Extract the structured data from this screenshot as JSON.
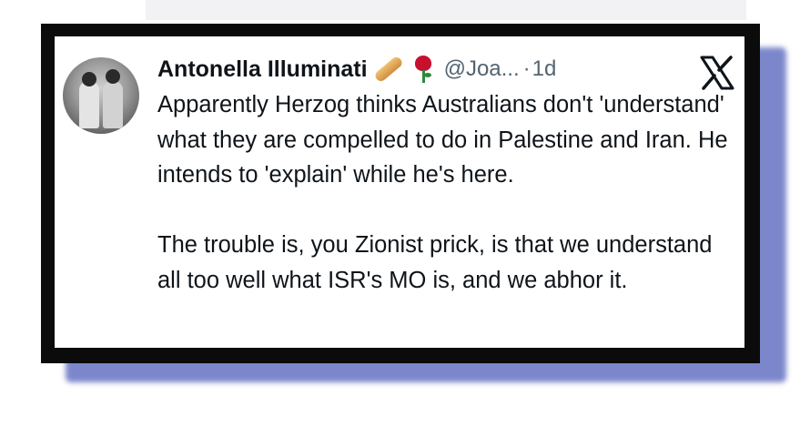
{
  "post": {
    "author_name": "Antonella Illuminati",
    "author_emojis": [
      "baguette-emoji",
      "rose-emoji"
    ],
    "handle": "@Joa...",
    "separator": "·",
    "time_ago": "1d",
    "platform_logo": "x-logo-icon",
    "paragraphs": [
      "Apparently Herzog thinks Australians don't 'understand' what they are compelled to do in Palestine and Iran. He intends to 'explain' while he's here.",
      "The trouble is, you Zionist prick, is that we understand all too well what ISR's MO is, and we abhor it."
    ]
  },
  "colors": {
    "frame": "#0b0b0b",
    "shadow": "#6673c2",
    "text": "#0f1419",
    "muted": "#536471"
  }
}
